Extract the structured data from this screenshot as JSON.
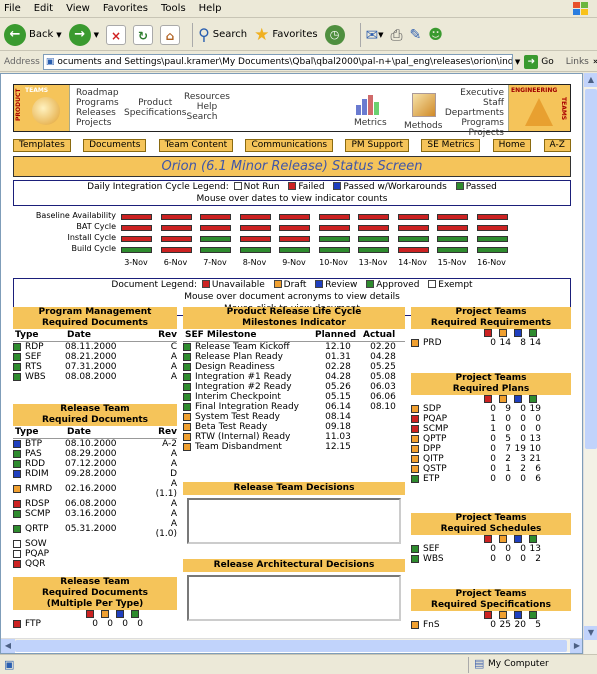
{
  "menu": [
    "File",
    "Edit",
    "View",
    "Favorites",
    "Tools",
    "Help"
  ],
  "toolbar": {
    "back": "Back",
    "search": "Search",
    "favorites": "Favorites"
  },
  "address": {
    "label": "Address",
    "url": "ocuments and Settings\\paul.kramer\\My Documents\\Qbal\\qbal2000\\pal-n+\\pal_eng\\releases\\orion\\index.htm",
    "go": "Go",
    "links": "Links"
  },
  "banner": {
    "left_vert1": "PRODUCT",
    "left_vert2": "TEAMS",
    "left_links": [
      "Roadmap",
      "Programs",
      "Releases",
      "Projects"
    ],
    "mid1": [
      "Product",
      "Specifications"
    ],
    "mid2": [
      "Resources",
      "Help",
      "Search"
    ],
    "metrics": "Metrics",
    "methods": "Methods",
    "right_links": [
      "Executive Staff",
      "Departments",
      "Programs",
      "Projects"
    ],
    "right_vert1": "ENGINEERING",
    "right_vert2": "TEAMS"
  },
  "tabs": [
    "Templates",
    "Documents",
    "Team Content",
    "Communications",
    "PM Support",
    "SE Metrics",
    "Home",
    "A-Z"
  ],
  "title": "Orion (6.1 Minor Release) Status Screen",
  "legend": {
    "label": "Daily Integration Cycle Legend:",
    "items": [
      {
        "label": "Not Run",
        "color": "#ffffff"
      },
      {
        "label": "Failed",
        "color": "#cc2222"
      },
      {
        "label": "Passed w/Workarounds",
        "color": "#1f3fbf"
      },
      {
        "label": "Passed",
        "color": "#2e8b2e"
      }
    ],
    "hint": "Mouse over dates to view indicator counts"
  },
  "cycles": {
    "rows": [
      "Baseline Availability",
      "BAT Cycle",
      "Install Cycle",
      "Build Cycle"
    ],
    "dates": [
      "3-Nov",
      "6-Nov",
      "7-Nov",
      "8-Nov",
      "9-Nov",
      "10-Nov",
      "13-Nov",
      "14-Nov",
      "15-Nov",
      "16-Nov"
    ],
    "states": [
      [
        "F",
        "F",
        "F",
        "F",
        "F",
        "F",
        "F",
        "F",
        "F",
        "F"
      ],
      [
        "F",
        "F",
        "F",
        "F",
        "F",
        "F",
        "F",
        "F",
        "F",
        "F"
      ],
      [
        "F",
        "F",
        "P",
        "F",
        "F",
        "P",
        "P",
        "P",
        "P",
        "P"
      ],
      [
        "P",
        "F",
        "P",
        "P",
        "P",
        "P",
        "P",
        "F",
        "P",
        "P"
      ]
    ]
  },
  "doc_legend": {
    "label": "Document Legend:",
    "items": [
      {
        "label": "Unavailable",
        "color": "#cc2222"
      },
      {
        "label": "Draft",
        "color": "#f0a030"
      },
      {
        "label": "Review",
        "color": "#1f3fbf"
      },
      {
        "label": "Approved",
        "color": "#2e8b2e"
      },
      {
        "label": "Exempt",
        "color": "#ffffff"
      }
    ],
    "hint1": "Mouse over document acronyms to view details",
    "hint2": "Mouse click to view document"
  },
  "pm": {
    "title1": "Program Management",
    "title2": "Required Documents",
    "cols": [
      "Type",
      "Date",
      "Rev"
    ],
    "rows": [
      {
        "t": "RDP",
        "d": "08.11.2000",
        "r": "C",
        "c": "#2e8b2e"
      },
      {
        "t": "SEF",
        "d": "08.21.2000",
        "r": "A",
        "c": "#2e8b2e"
      },
      {
        "t": "RTS",
        "d": "07.31.2000",
        "r": "A",
        "c": "#2e8b2e"
      },
      {
        "t": "WBS",
        "d": "08.08.2000",
        "r": "A",
        "c": "#2e8b2e"
      }
    ]
  },
  "rt": {
    "title1": "Release Team",
    "title2": "Required Documents",
    "cols": [
      "Type",
      "Date",
      "Rev"
    ],
    "rows": [
      {
        "t": "BTP",
        "d": "08.10.2000",
        "r": "A-2",
        "c": "#1f3fbf"
      },
      {
        "t": "PAS",
        "d": "08.29.2000",
        "r": "A",
        "c": "#2e8b2e"
      },
      {
        "t": "RDD",
        "d": "07.12.2000",
        "r": "A",
        "c": "#2e8b2e"
      },
      {
        "t": "RDIM",
        "d": "09.28.2000",
        "r": "D",
        "c": "#1f3fbf"
      },
      {
        "t": "RMRD",
        "d": "02.16.2000",
        "r": "A (1.1)",
        "c": "#f0a030"
      },
      {
        "t": "RDSP",
        "d": "06.08.2000",
        "r": "A",
        "c": "#cc2222"
      },
      {
        "t": "SCMP",
        "d": "03.16.2000",
        "r": "A",
        "c": "#2e8b2e"
      },
      {
        "t": "QRTP",
        "d": "05.31.2000",
        "r": "A (1.0)",
        "c": "#2e8b2e"
      },
      {
        "t": "SOW",
        "d": "",
        "r": "",
        "c": "#ffffff"
      },
      {
        "t": "PQAP",
        "d": "",
        "r": "",
        "c": "#ffffff"
      },
      {
        "t": "QQR",
        "d": "",
        "r": "",
        "c": "#cc2222"
      }
    ]
  },
  "rtm": {
    "title1": "Release Team",
    "title2": "Required Documents",
    "title3": "(Multiple Per Type)",
    "rows": [
      {
        "t": "FTP",
        "v": [
          "0",
          "0",
          "0",
          "0"
        ],
        "c": "#cc2222"
      }
    ]
  },
  "ms": {
    "title1": "Product Release Life Cycle",
    "title2": "Milestones Indicator",
    "cols": [
      "SEF Milestone",
      "Planned",
      "Actual"
    ],
    "rows": [
      {
        "m": "Release Team Kickoff",
        "p": "12.10",
        "a": "02.20",
        "c": "#2e8b2e"
      },
      {
        "m": "Release Plan Ready",
        "p": "01.31",
        "a": "04.28",
        "c": "#2e8b2e"
      },
      {
        "m": "Design Readiness",
        "p": "02.28",
        "a": "05.25",
        "c": "#2e8b2e"
      },
      {
        "m": "Integration #1 Ready",
        "p": "04.28",
        "a": "05.08",
        "c": "#2e8b2e"
      },
      {
        "m": "Integration #2 Ready",
        "p": "05.26",
        "a": "06.03",
        "c": "#2e8b2e"
      },
      {
        "m": "Interim Checkpoint",
        "p": "05.15",
        "a": "06.06",
        "c": "#2e8b2e"
      },
      {
        "m": "Final Integration Ready",
        "p": "06.14",
        "a": "08.10",
        "c": "#2e8b2e"
      },
      {
        "m": "System Test Ready",
        "p": "08.14",
        "a": "",
        "c": "#f0a030"
      },
      {
        "m": "Beta Test Ready",
        "p": "09.18",
        "a": "",
        "c": "#f0a030"
      },
      {
        "m": "RTW (Internal) Ready",
        "p": "11.03",
        "a": "",
        "c": "#f0a030"
      },
      {
        "m": "Team Disbandment",
        "p": "12.15",
        "a": "",
        "c": "#f0a030"
      }
    ]
  },
  "decisions": {
    "title": "Release Team Decisions"
  },
  "arch": {
    "title": "Release Architectural Decisions"
  },
  "pt_req": {
    "title1": "Project Teams",
    "title2": "Required Requirements",
    "rows": [
      {
        "t": "PRD",
        "v": [
          "0",
          "14",
          "8",
          "14"
        ],
        "c": "#f0a030"
      }
    ]
  },
  "pt_plans": {
    "title1": "Project Teams",
    "title2": "Required Plans",
    "rows": [
      {
        "t": "SDP",
        "v": [
          "0",
          "9",
          "0",
          "19"
        ],
        "c": "#f0a030"
      },
      {
        "t": "PQAP",
        "v": [
          "1",
          "0",
          "0",
          "0"
        ],
        "c": "#cc2222"
      },
      {
        "t": "SCMP",
        "v": [
          "1",
          "0",
          "0",
          "0"
        ],
        "c": "#cc2222"
      },
      {
        "t": "QPTP",
        "v": [
          "0",
          "5",
          "0",
          "13"
        ],
        "c": "#f0a030"
      },
      {
        "t": "DPP",
        "v": [
          "0",
          "7",
          "19",
          "10"
        ],
        "c": "#f0a030"
      },
      {
        "t": "QITP",
        "v": [
          "0",
          "2",
          "3",
          "21"
        ],
        "c": "#f0a030"
      },
      {
        "t": "QSTP",
        "v": [
          "0",
          "1",
          "2",
          "6"
        ],
        "c": "#f0a030"
      },
      {
        "t": "ETP",
        "v": [
          "0",
          "0",
          "0",
          "6"
        ],
        "c": "#2e8b2e"
      }
    ]
  },
  "pt_sched": {
    "title1": "Project Teams",
    "title2": "Required Schedules",
    "rows": [
      {
        "t": "SEF",
        "v": [
          "0",
          "0",
          "0",
          "13"
        ],
        "c": "#2e8b2e"
      },
      {
        "t": "WBS",
        "v": [
          "0",
          "0",
          "0",
          "2"
        ],
        "c": "#2e8b2e"
      }
    ]
  },
  "pt_spec": {
    "title1": "Project Teams",
    "title2": "Required Specifications",
    "rows": [
      {
        "t": "FnS",
        "v": [
          "0",
          "25",
          "20",
          "5"
        ],
        "c": "#f0a030"
      }
    ]
  },
  "status": {
    "zone": "My Computer"
  }
}
